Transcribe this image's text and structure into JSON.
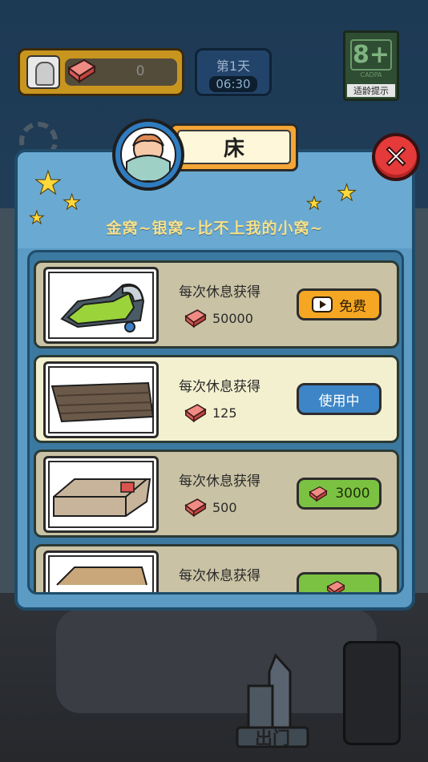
{
  "hud": {
    "brick_count": "0",
    "day_label": "第1天",
    "time": "06:30",
    "age_rating": "8+",
    "age_org": "CADPA",
    "age_hint": "适龄提示"
  },
  "modal": {
    "title": "床",
    "subtitle": "金窝~银窝~比不上我的小窝~",
    "items": [
      {
        "desc": "每次休息获得",
        "reward": "50000",
        "button_label": "免费",
        "state": "free"
      },
      {
        "desc": "每次休息获得",
        "reward": "125",
        "button_label": "使用中",
        "state": "using"
      },
      {
        "desc": "每次休息获得",
        "reward": "500",
        "button_label": "3000",
        "state": "buy"
      },
      {
        "desc": "每次休息获得",
        "reward": "",
        "button_label": "",
        "state": "buy"
      }
    ]
  },
  "bottom": {
    "exit_label": "出门"
  },
  "colors": {
    "modal_bg": "#5b9bc4",
    "free_button": "#f5a623",
    "using_button": "#3d85c6",
    "buy_button": "#7cc242",
    "close_button": "#e53a3a"
  }
}
